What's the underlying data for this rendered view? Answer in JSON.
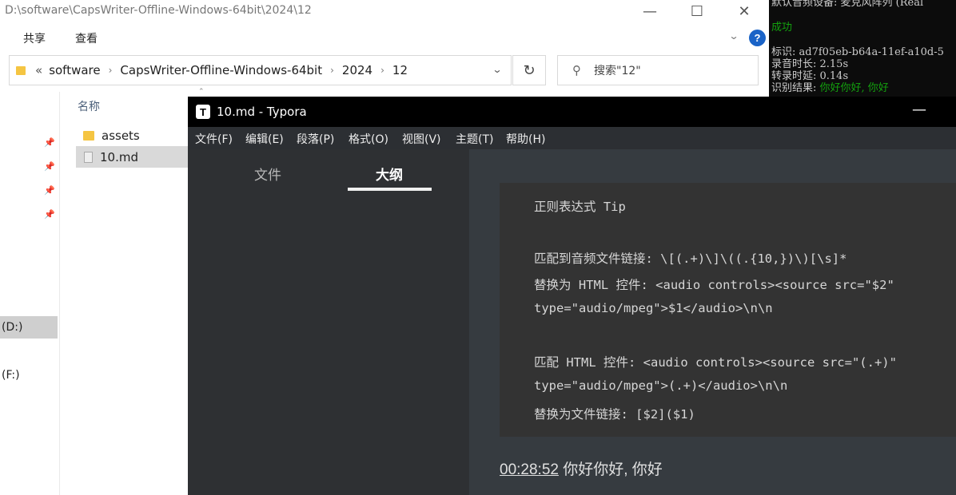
{
  "explorer": {
    "title": "D:\\software\\CapsWriter-Offline-Windows-64bit\\2024\\12",
    "ribbon_tabs": [
      "共享",
      "查看"
    ],
    "breadcrumbs": [
      "software",
      "CapsWriter-Offline-Windows-64bit",
      "2024",
      "12"
    ],
    "breadcrumb_prefix": "«",
    "search_placeholder": "搜索\"12\"",
    "column_header": "名称",
    "files": [
      {
        "name": "assets",
        "type": "folder"
      },
      {
        "name": "10.md",
        "type": "markdown"
      }
    ],
    "drives": [
      "(D:)",
      "(F:)"
    ],
    "help": "?"
  },
  "terminal": {
    "lines": [
      {
        "text": "默认音频设备: 麦克风阵列 (Real",
        "color": "#cccccc"
      },
      {
        "text": "成功",
        "color": "#13a10e"
      },
      {
        "text": "标识: ad7f05eb-b64a-11ef-a10d-5",
        "color": "#cccccc"
      },
      {
        "text": "录音时长: 2.15s",
        "color": "#cccccc"
      },
      {
        "text": "转录时延: 0.14s",
        "color": "#cccccc"
      }
    ],
    "result_label": "识别结果: ",
    "result_text": "你好你好, 你好"
  },
  "typora": {
    "title": "10.md - Typora",
    "logo": "T",
    "menu": [
      "文件(F)",
      "编辑(E)",
      "段落(P)",
      "格式(O)",
      "视图(V)",
      "主题(T)",
      "帮助(H)"
    ],
    "sidebar_tabs": [
      "文件",
      "大纲"
    ],
    "active_tab": "大纲",
    "code_lines": [
      "正则表达式 Tip",
      "",
      "匹配到音频文件链接: \\[(.+)\\]\\((.{10,})\\)[\\s]*",
      "替换为 HTML 控件: <audio controls><source src=\"$2\"",
      "type=\"audio/mpeg\">$1</audio>\\n\\n",
      "",
      "匹配 HTML 控件: <audio controls><source src=\"(.+)\"",
      "type=\"audio/mpeg\">(.+)</audio>\\n\\n",
      "替换为文件链接: [$2]($1)"
    ],
    "paragraph_time": "00:28:52",
    "paragraph_text": " 你好你好, 你好"
  },
  "colors": {
    "typora_bg": "#363b40",
    "terminal_green": "#13a10e",
    "help_blue": "#1a63c7"
  }
}
